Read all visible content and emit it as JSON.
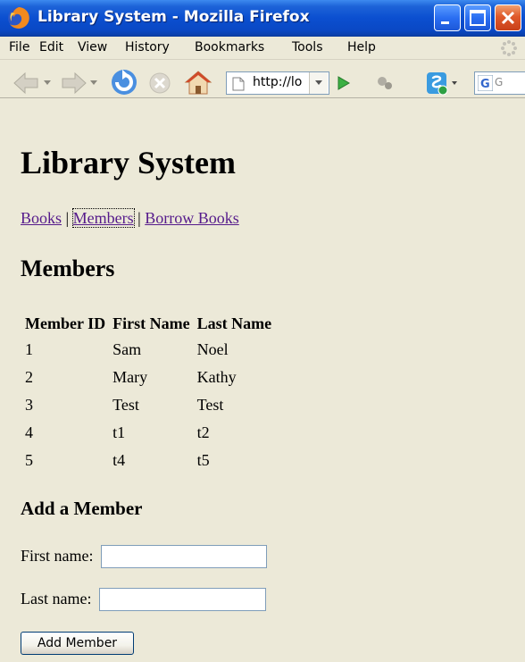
{
  "window": {
    "title": "Library System - Mozilla Firefox"
  },
  "menu": [
    {
      "label": "File"
    },
    {
      "label": "Edit"
    },
    {
      "label": "View"
    },
    {
      "label": "History"
    },
    {
      "label": "Bookmarks"
    },
    {
      "label": "Tools"
    },
    {
      "label": "Help"
    }
  ],
  "toolbar": {
    "url": "http://lo",
    "search_placeholder": "G"
  },
  "page": {
    "title": "Library System",
    "nav": {
      "books": "Books",
      "members": "Members",
      "borrow": "Borrow Books",
      "separator": "|"
    },
    "section_title": "Members",
    "table": {
      "headers": [
        "Member ID",
        "First Name",
        "Last Name"
      ],
      "rows": [
        [
          "1",
          "Sam",
          "Noel"
        ],
        [
          "2",
          "Mary",
          "Kathy"
        ],
        [
          "3",
          "Test",
          "Test"
        ],
        [
          "4",
          "t1",
          "t2"
        ],
        [
          "5",
          "t4",
          "t5"
        ]
      ]
    },
    "add_section_title": "Add a Member",
    "form": {
      "first_name_label": "First name:",
      "first_name_value": "",
      "last_name_label": "Last name:",
      "last_name_value": "",
      "submit_label": "Add Member"
    }
  },
  "colors": {
    "background": "#ece9d8",
    "link_visited": "#551a8b",
    "titlebar": "#0b4fd0"
  }
}
